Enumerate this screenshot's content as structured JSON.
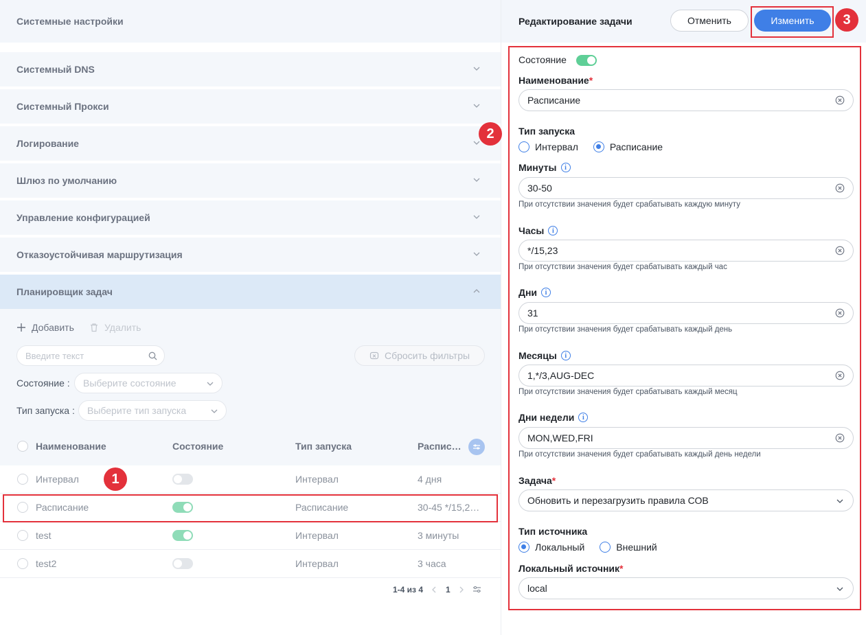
{
  "left": {
    "header": "Системные настройки",
    "sections": [
      "Системный DNS",
      "Системный Прокси",
      "Логирование",
      "Шлюз по умолчанию",
      "Управление конфигурацией",
      "Отказоустойчивая маршрутизация",
      "Планировщик задач"
    ],
    "toolbar": {
      "add": "Добавить",
      "delete": "Удалить"
    },
    "search_placeholder": "Введите текст",
    "reset_filters": "Сбросить фильтры",
    "filters": {
      "state_label": "Состояние :",
      "state_placeholder": "Выберите состояние",
      "type_label": "Тип запуска :",
      "type_placeholder": "Выберите тип запуска"
    },
    "table": {
      "columns": [
        "Наименование",
        "Состояние",
        "Тип запуска",
        "Распис…"
      ],
      "rows": [
        {
          "name": "Интервал",
          "enabled": false,
          "type": "Интервал",
          "schedule": "4 дня"
        },
        {
          "name": "Расписание",
          "enabled": true,
          "type": "Расписание",
          "schedule": "30-45 */15,2…"
        },
        {
          "name": "test",
          "enabled": true,
          "type": "Интервал",
          "schedule": "3 минуты"
        },
        {
          "name": "test2",
          "enabled": false,
          "type": "Интервал",
          "schedule": "3 часа"
        }
      ]
    },
    "pagination": {
      "range": "1-4 из 4",
      "page": "1"
    }
  },
  "badges": [
    "1",
    "2",
    "3"
  ],
  "right": {
    "title": "Редактирование задачи",
    "cancel": "Отменить",
    "save": "Изменить",
    "state_label": "Состояние",
    "state_enabled": true,
    "name_label": "Наименование",
    "required_mark": "*",
    "name_value": "Расписание",
    "launch_type_label": "Тип запуска",
    "launch_options": [
      "Интервал",
      "Расписание"
    ],
    "launch_selected": "Расписание",
    "minutes_label": "Минуты",
    "minutes_value": "30-50",
    "minutes_hint": "При отсутствии значения будет срабатывать каждую минуту",
    "hours_label": "Часы",
    "hours_value": "*/15,23",
    "hours_hint": "При отсутствии значения будет срабатывать каждый час",
    "days_label": "Дни",
    "days_value": "31",
    "days_hint": "При отсутствии значения будет срабатывать каждый день",
    "months_label": "Месяцы",
    "months_value": "1,*/3,AUG-DEC",
    "months_hint": "При отсутствии значения будет срабатывать каждый месяц",
    "weekdays_label": "Дни недели",
    "weekdays_value": "MON,WED,FRI",
    "weekdays_hint": "При отсутствии значения будет срабатывать каждый день недели",
    "task_label": "Задача",
    "task_value": "Обновить и перезагрузить правила СОВ",
    "source_type_label": "Тип источника",
    "source_options": [
      "Локальный",
      "Внешний"
    ],
    "source_selected": "Локальный",
    "local_source_label": "Локальный источник",
    "local_source_value": "local"
  },
  "colors": {
    "accent": "#3f7fe6",
    "highlight": "#e3313b",
    "toggle_on": "#8fdcb8"
  }
}
